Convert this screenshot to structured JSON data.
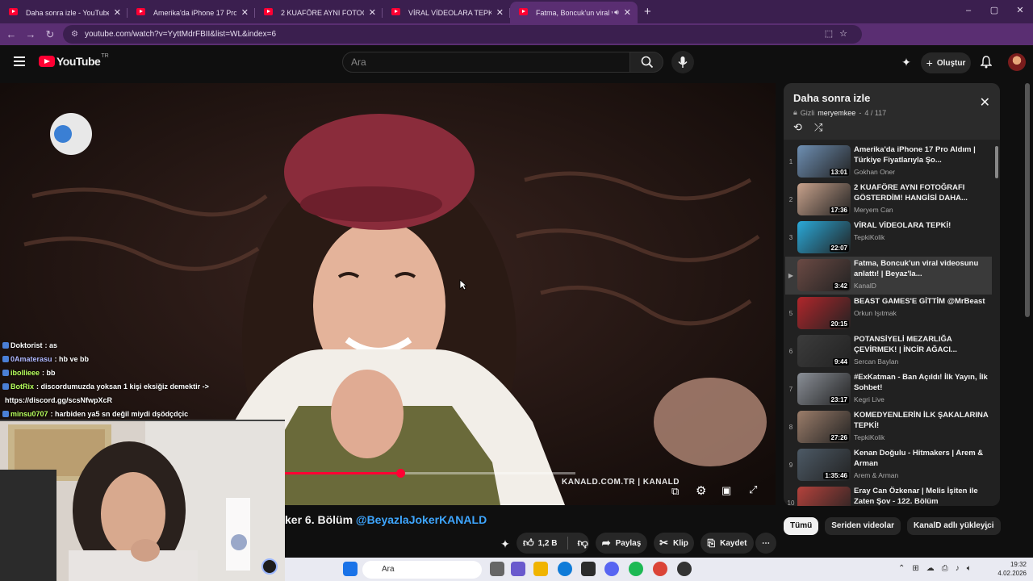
{
  "browser": {
    "tabs": [
      {
        "title": "Daha sonra izle - YouTube",
        "active": false
      },
      {
        "title": "Amerika'da iPhone 17 Pro Aldım",
        "active": false
      },
      {
        "title": "2 KUAFÖRE AYNI FOTOĞRAFI G",
        "active": false
      },
      {
        "title": "VİRAL VİDEOLARA TEPKİ! - You",
        "active": false
      },
      {
        "title": "Fatma, Boncuk'un viral vide",
        "active": true
      }
    ],
    "new_tab_glyph": "+",
    "url": "youtube.com/watch?v=YyttMdrFBII&list=WL&index=6",
    "window_controls": [
      "–",
      "▢",
      "✕"
    ]
  },
  "youtube_header": {
    "logo_text": "YouTube",
    "country_code": "TR",
    "search_placeholder": "Ara",
    "create_label": "Oluştur"
  },
  "chat": [
    {
      "user": "Doktorist",
      "message": ": as",
      "color": "#ffffff"
    },
    {
      "user": "0Amaterasu",
      "message": ": hb ve bb",
      "color": "#b0b8ff"
    },
    {
      "user": "ibollieee",
      "message": ": bb",
      "color": "#b6ff5c"
    },
    {
      "user": "BotRix",
      "message": ": discordumuzda yoksan 1 kişi eksiğiz demektir ->",
      "color": "#b6ff5c"
    },
    {
      "user": "",
      "message": "https://discord.gg/scsNfwpXcR",
      "color": "#ffffff"
    },
    {
      "user": "minsu0707",
      "message": ": harbiden ya5 sn değil miydi dşödçdçic",
      "color": "#b6ff5c"
    }
  ],
  "video": {
    "watermark": "KANALD.COM.TR | KANALD",
    "progress": 0.21,
    "title_prefix": "ker 6. Bölüm ",
    "title_link": "@BeyazlaJokerKANALD",
    "actions": {
      "like_count": "1,2 B",
      "share": "Paylaş",
      "clip": "Klip",
      "save": "Kaydet"
    }
  },
  "playlist": {
    "title": "Daha sonra izle",
    "privacy": "Gizli",
    "owner": "meryemkee",
    "position": "4 / 117",
    "items": [
      {
        "num": "1",
        "title": "Amerika'da iPhone 17 Pro Aldım | Türkiye Fiyatlarıyla Şo...",
        "channel": "Gokhan Oner",
        "duration": "13:01",
        "color": "#6e8fb3"
      },
      {
        "num": "2",
        "title": "2 KUAFÖRE AYNI FOTOĞRAFI GÖSTERDİM! HANGİSİ DAHA...",
        "channel": "Meryem Can",
        "duration": "17:36",
        "color": "#c8a28c"
      },
      {
        "num": "3",
        "title": "VİRAL VİDEOLARA TEPKİ!",
        "channel": "TepkiKolik",
        "duration": "22:07",
        "color": "#2aa9d9"
      },
      {
        "num": "▶",
        "title": "Fatma, Boncuk'un viral videosunu anlattı! | Beyaz'la...",
        "channel": "KanalD",
        "duration": "3:42",
        "color": "#6b4a44"
      },
      {
        "num": "5",
        "title": "BEAST GAMES'E GİTTİM @MrBeast",
        "channel": "Orkun Işıtmak",
        "duration": "20:15",
        "color": "#b0262b"
      },
      {
        "num": "6",
        "title": "POTANSİYELİ MEZARLIĞA ÇEVİRMEK! | İNCİR AĞACI...",
        "channel": "Sercan Baylan",
        "duration": "9:44",
        "color": "#3c3c3c"
      },
      {
        "num": "7",
        "title": "#ExKatman - Ban Açıldı! İlk Yayın, İlk Sohbet!",
        "channel": "Kegri Live",
        "duration": "23:17",
        "color": "#8a8f97"
      },
      {
        "num": "8",
        "title": "KOMEDYENLERİN İLK ŞAKALARINA TEPKİ!",
        "channel": "TepkiKolik",
        "duration": "27:26",
        "color": "#9b7d6a"
      },
      {
        "num": "9",
        "title": "Kenan Doğulu - Hitmakers | Arem & Arman",
        "channel": "Arem & Arman",
        "duration": "1:35:46",
        "color": "#4d5a66"
      },
      {
        "num": "10",
        "title": "Eray Can Özkenar | Melis İşiten ile Zaten Şov - 122. Bölüm",
        "channel": "",
        "duration": "54:11",
        "color": "#b5423c"
      }
    ]
  },
  "chips": [
    {
      "label": "Tümü",
      "active": true
    },
    {
      "label": "Seriden videolar",
      "active": false
    },
    {
      "label": "KanalD adlı yükleyici",
      "active": false
    }
  ],
  "taskbar": {
    "search_placeholder": "Ara",
    "time": "19:32",
    "date": "4.02.2026"
  }
}
